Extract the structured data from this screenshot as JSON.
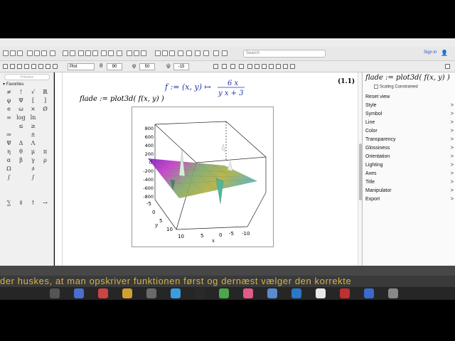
{
  "toolbar": {
    "search_placeholder": "Search",
    "sign_in": "Sign in"
  },
  "plot_toolbar": {
    "type": "Plot",
    "theta_symbol": "θ",
    "theta_value": "90",
    "phi_symbol": "φ",
    "phi_value": "50",
    "psi_symbol": "ψ",
    "psi_value": "-15"
  },
  "palette": {
    "search_placeholder": "Palettes",
    "header": "Favorites",
    "symbols": [
      "≠",
      "!",
      "√",
      "ℝ",
      "φ",
      "Ψ",
      "[",
      "]",
      "e",
      "ω",
      "×",
      "Ø",
      "∞",
      "log",
      "ln",
      "",
      "",
      "≤",
      "≥",
      "",
      "⇒",
      "",
      "±",
      "",
      "Ψ",
      "Δ",
      "Λ",
      "",
      "η",
      "θ",
      "μ",
      "π",
      "α",
      "β",
      "γ",
      "ρ",
      "Ω",
      "",
      "∂",
      "",
      "∫",
      "",
      "∫",
      "",
      "",
      "",
      "",
      "",
      "",
      "",
      "",
      "",
      "∑",
      "⇓",
      "↑",
      "→"
    ]
  },
  "document": {
    "output_math": "f := (x, y) ↦ 6 x / (y x + 3)",
    "output_label": "(1.1)",
    "input_math": "flade := plot3d( f(x, y) )",
    "z_ticks": [
      "800",
      "600",
      "400",
      "200",
      "0",
      "-200",
      "-400",
      "-600",
      "-800"
    ],
    "y_ticks": [
      "-5",
      "0",
      "5",
      "10"
    ],
    "x_ticks": [
      "10",
      "5",
      "0",
      "-5",
      "-10"
    ],
    "axis_x": "x",
    "axis_y": "y"
  },
  "context_panel": {
    "title": "flade := plot3d( f(x, y) )",
    "scaling": "Scaling Constrained",
    "items": [
      "Reset view",
      "Style",
      "Symbol",
      "Line",
      "Color",
      "Transparency",
      "Glossiness",
      "Orientation",
      "Lighting",
      "Axes",
      "Title",
      "Manipulator",
      "Export"
    ]
  },
  "subtitle": "der huskes, at man opskriver funktionen først og dernæst vælger den korrekte",
  "colors": {
    "math_blue": "#2233aa",
    "subtitle_gold": "#d4b44a",
    "link_blue": "#2a53c6"
  }
}
